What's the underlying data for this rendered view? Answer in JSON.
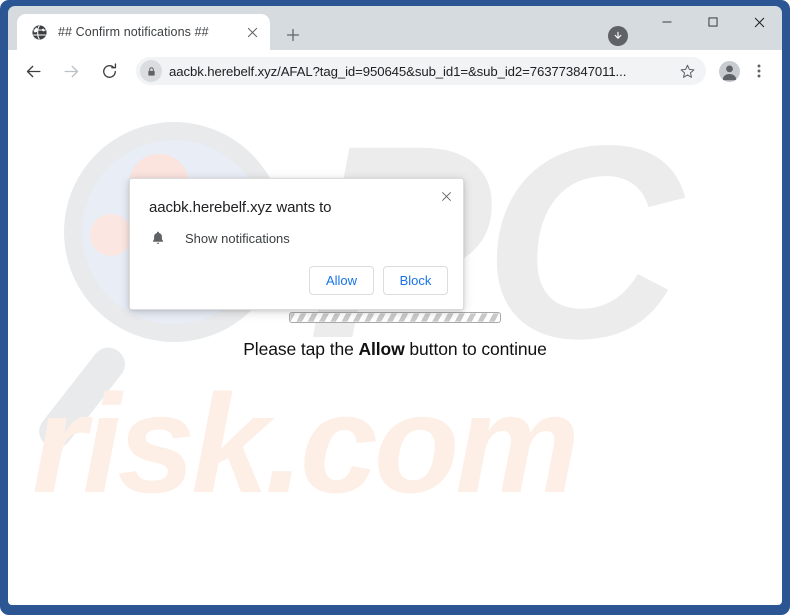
{
  "window": {
    "frame_color": "#2c5693",
    "controls": {
      "minimize": "─",
      "maximize": "☐",
      "close": "✕"
    }
  },
  "tab_strip": {
    "tabs": [
      {
        "favicon": "globe-icon",
        "title": "## Confirm notifications ##",
        "close_label": "✕"
      }
    ],
    "new_tab_label": "+",
    "download_icon": "download-arrow-icon"
  },
  "toolbar": {
    "back_icon": "back-arrow-icon",
    "forward_icon": "forward-arrow-icon",
    "reload_icon": "reload-icon",
    "lock_icon": "lock-icon",
    "url": "aacbk.herebelf.xyz/AFAL?tag_id=950645&sub_id1=&sub_id2=763773847011...",
    "star_icon": "bookmark-star-icon",
    "avatar_icon": "profile-avatar-icon",
    "menu_icon": "three-dot-menu-icon"
  },
  "page": {
    "watermark_top": "PC",
    "watermark_bottom": "risk.com",
    "watermark_top_color": "#ececed",
    "watermark_bottom_color": "#fdefe6",
    "magnifier_color": "#e9eaec",
    "magnifier_lens_color": "#e8edf6",
    "progress_label": "loading-progress-bar",
    "caption_prefix": "Please tap the ",
    "caption_bold": "Allow",
    "caption_suffix": " button to continue"
  },
  "permission_dialog": {
    "title": "aacbk.herebelf.xyz wants to",
    "close_label": "✕",
    "bell_icon": "bell-icon",
    "request_label": "Show notifications",
    "allow_label": "Allow",
    "block_label": "Block",
    "button_text_color": "#1a73e8"
  }
}
